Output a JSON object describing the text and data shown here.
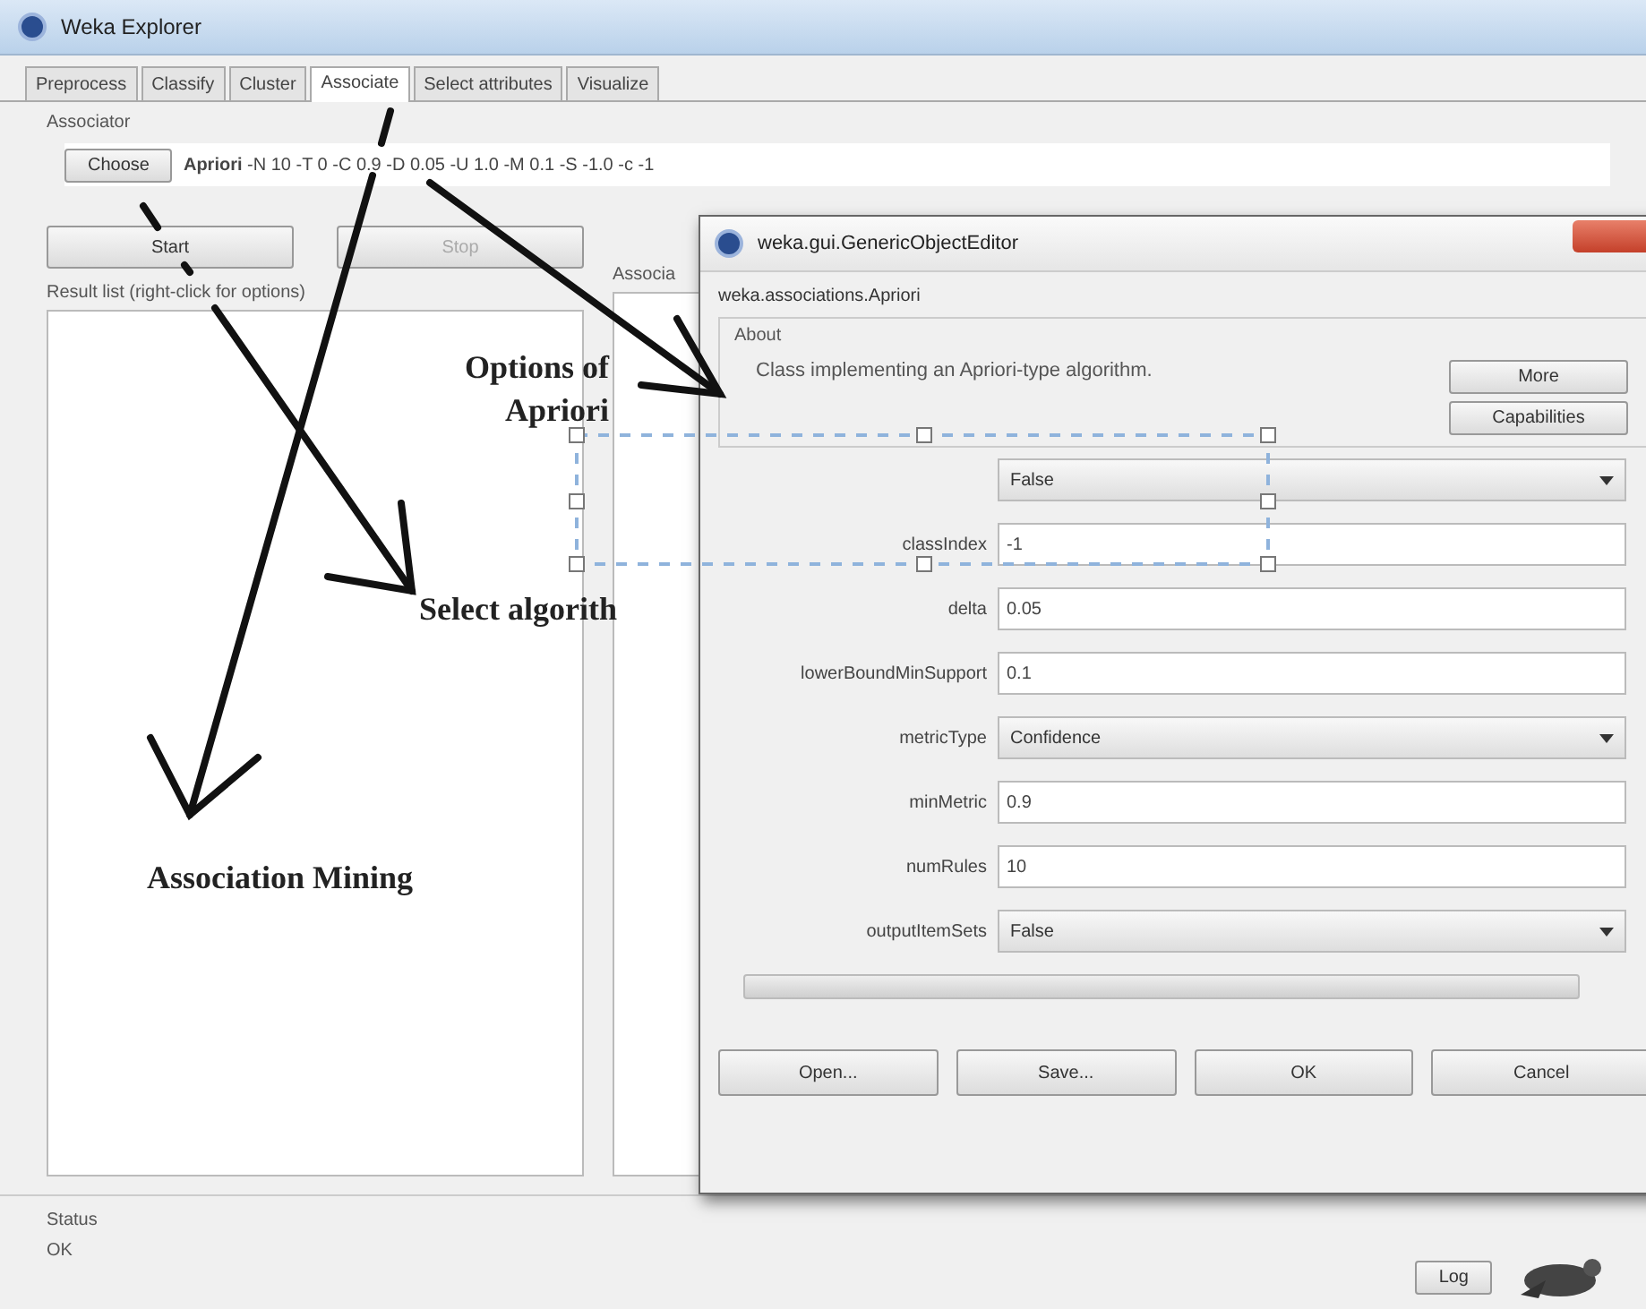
{
  "window": {
    "title": "Weka Explorer"
  },
  "tabs": [
    {
      "label": "Preprocess",
      "selected": false
    },
    {
      "label": "Classify",
      "selected": false
    },
    {
      "label": "Cluster",
      "selected": false
    },
    {
      "label": "Associate",
      "selected": true
    },
    {
      "label": "Select attributes",
      "selected": false
    },
    {
      "label": "Visualize",
      "selected": false
    }
  ],
  "associator": {
    "group_label": "Associator",
    "choose_button": "Choose",
    "command_name": "Apriori",
    "command_args": "-N 10 -T 0 -C 0.9 -D 0.05 -U 1.0 -M 0.1 -S -1.0 -c -1"
  },
  "run_buttons": [
    {
      "label": "Start",
      "disabled": false
    },
    {
      "label": "Stop",
      "disabled": true
    }
  ],
  "result_list": {
    "label": "Result list (right-click for options)"
  },
  "output": {
    "label": "Associa"
  },
  "status": {
    "label": "Status",
    "text": "OK",
    "log_button": "Log"
  },
  "dialog": {
    "title": "weka.gui.GenericObjectEditor",
    "class_name": "weka.associations.Apriori",
    "about": {
      "label": "About",
      "text": "Class implementing an Apriori-type algorithm.",
      "buttons": [
        "More",
        "Capabilities"
      ]
    },
    "properties": [
      {
        "kind": "dropdown",
        "value": "False"
      },
      {
        "kind": "text",
        "label": "classIndex",
        "value": "-1"
      },
      {
        "kind": "text",
        "label": "delta",
        "value": "0.05"
      },
      {
        "kind": "text",
        "label": "lowerBoundMinSupport",
        "value": "0.1"
      },
      {
        "kind": "dropdown",
        "label": "metricType",
        "value": "Confidence"
      },
      {
        "kind": "text",
        "label": "minMetric",
        "value": "0.9"
      },
      {
        "kind": "text",
        "label": "numRules",
        "value": "10"
      },
      {
        "kind": "dropdown",
        "label": "outputItemSets",
        "value": "False"
      }
    ],
    "buttons": [
      "Open...",
      "Save...",
      "OK",
      "Cancel"
    ]
  },
  "annotations": [
    {
      "text": "Options of Apriori"
    },
    {
      "text": "Select algorith"
    },
    {
      "text": "Association Mining"
    }
  ]
}
